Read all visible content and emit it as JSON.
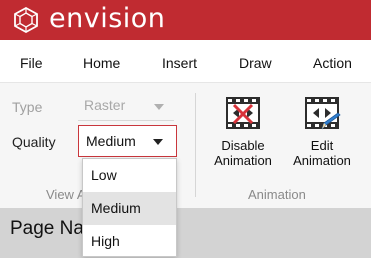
{
  "app": {
    "name": "envision"
  },
  "menu": {
    "items": [
      "File",
      "Home",
      "Insert",
      "Draw",
      "Action"
    ]
  },
  "ribbon": {
    "view_group": {
      "label": "View A",
      "type_label": "Type",
      "type_value": "Raster",
      "quality_label": "Quality",
      "quality_value": "Medium"
    },
    "animation_group": {
      "label": "Animation",
      "disable_line1": "Disable",
      "disable_line2": "Animation",
      "edit_line1": "Edit",
      "edit_line2": "Animation"
    }
  },
  "page": {
    "title": "Page Na"
  },
  "quality_dropdown": {
    "options": [
      "Low",
      "Medium",
      "High"
    ],
    "selected": "Medium"
  },
  "colors": {
    "brand_red": "#c02b31",
    "ribbon_bg": "#f6f6f6",
    "page_bar": "#d3d3d3"
  },
  "icons": {
    "logo": "envision-cube-logo",
    "disable_animation": "film-strip-with-x-icon",
    "edit_animation": "film-strip-with-pencil-icon"
  }
}
